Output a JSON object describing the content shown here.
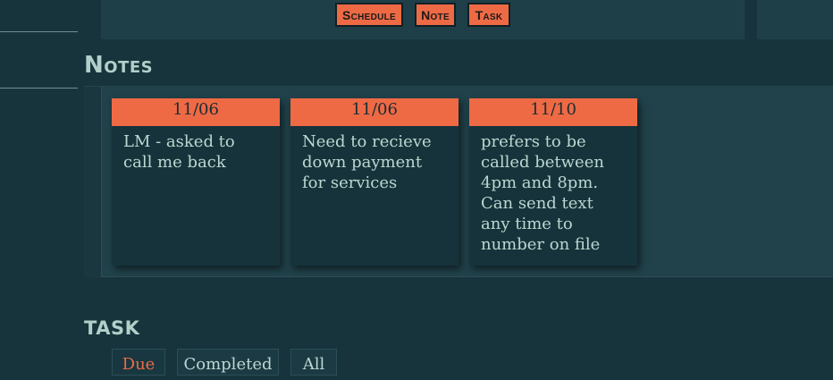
{
  "actions": [
    {
      "label": "Schedule"
    },
    {
      "label": "Note"
    },
    {
      "label": "Task"
    }
  ],
  "notes_section": {
    "title": "Notes",
    "cards": [
      {
        "date": "11/06",
        "text": "LM - asked to call me back"
      },
      {
        "date": "11/06",
        "text": "Need to recieve down payment for services"
      },
      {
        "date": "11/10",
        "text": "prefers to be called between 4pm and 8pm. Can send text any time to number on file"
      }
    ]
  },
  "task_section": {
    "title": "TASK",
    "tabs": [
      {
        "label": "Due",
        "active": true
      },
      {
        "label": "Completed",
        "active": false
      },
      {
        "label": "All",
        "active": false
      }
    ]
  },
  "colors": {
    "background": "#17343d",
    "panel": "#1f3f48",
    "card": "#16333b",
    "accent": "#ee6a45",
    "heading": "#b2cfc9",
    "text": "#bcd7d0"
  }
}
